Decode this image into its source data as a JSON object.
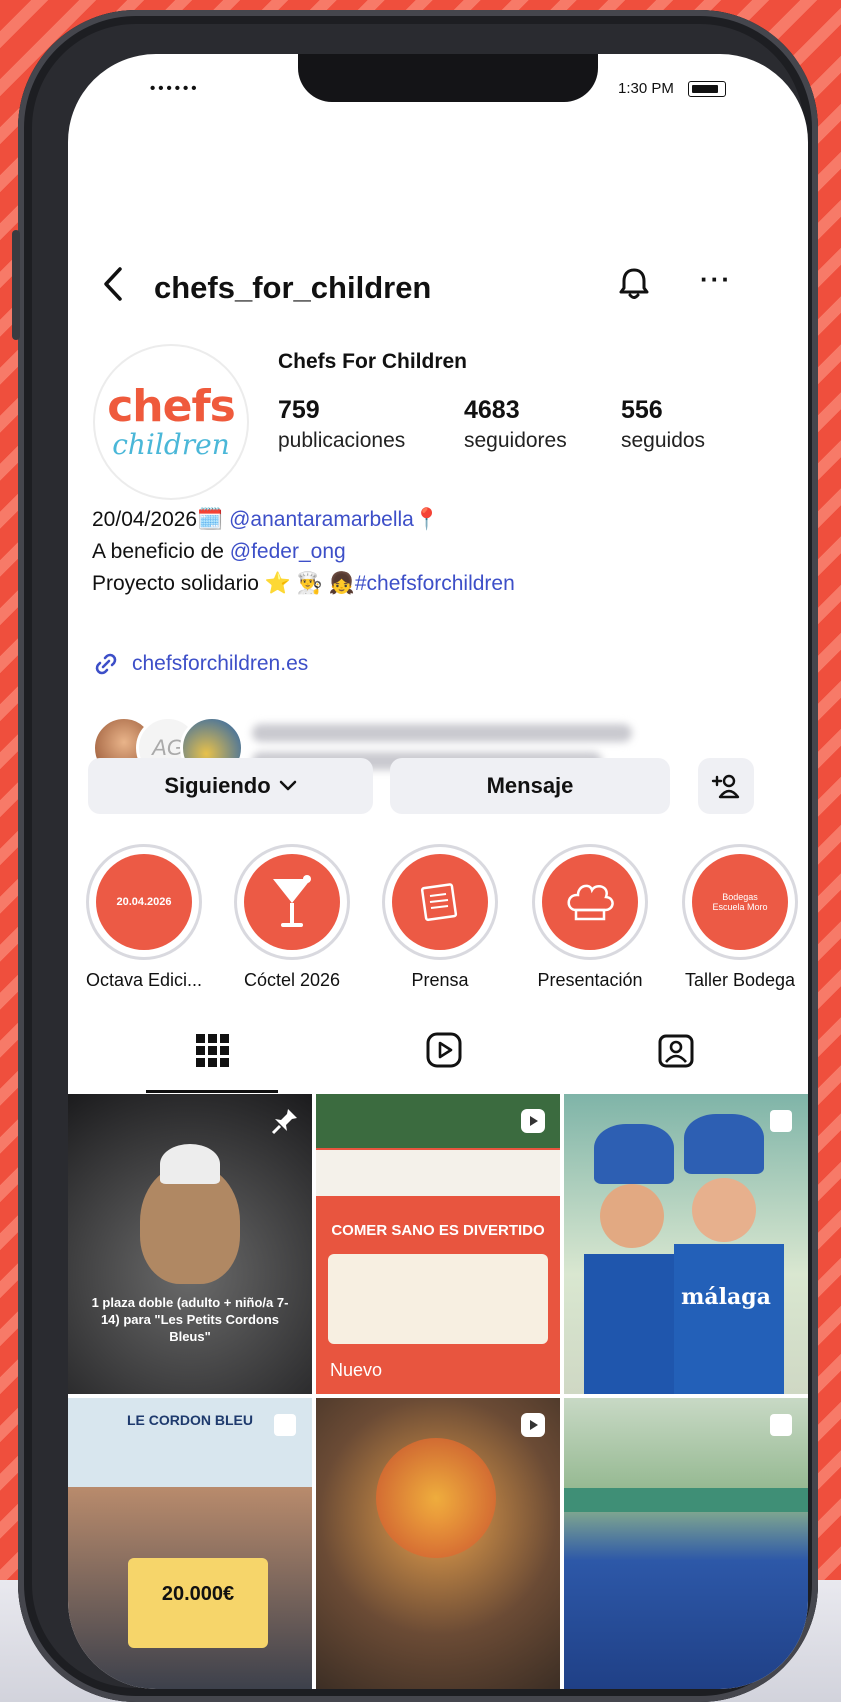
{
  "status_bar": {
    "carrier": "••••••",
    "time": "1:30 PM"
  },
  "header": {
    "username": "chefs_for_children"
  },
  "profile": {
    "logo_top": "chefs",
    "logo_bottom": "children",
    "display_name": "Chefs For Children",
    "stats": [
      {
        "value": "759",
        "label": "publicaciones"
      },
      {
        "value": "4683",
        "label": "seguidores"
      },
      {
        "value": "556",
        "label": "seguidos"
      }
    ],
    "bio": {
      "line1_text": "20/04/2026",
      "line1_emoji": "🗓️",
      "line1_mention": "@anantaramarbella",
      "line1_pin": "📍",
      "line2_text": "A beneficio de ",
      "line2_mention": "@feder_ong",
      "line3_text": "Proyecto solidario ⭐ 👨‍🍳 👧",
      "line3_hashtag": "#chefsforchildren",
      "url": "chefsforchildren.es"
    },
    "followers_preview": {
      "initials": "AG"
    }
  },
  "buttons": {
    "following": "Siguiendo",
    "message": "Mensaje"
  },
  "highlights": [
    {
      "label": "Octava Edici...",
      "inner_text": "20.04.2026"
    },
    {
      "label": "Cóctel 2026",
      "inner_text": ""
    },
    {
      "label": "Prensa",
      "inner_text": ""
    },
    {
      "label": "Presentación",
      "inner_text": ""
    },
    {
      "label": "Taller Bodega",
      "inner_text": "Bodegas Escuela Moro"
    }
  ],
  "posts": [
    {
      "caption": "1 plaza doble (adulto + niño/a 7-14) para \"Les Petits Cordons Bleus\"",
      "badge": "pin-icon"
    },
    {
      "caption": "COMER SANO ES DIVERTIDO",
      "tag": "Nuevo",
      "badge": "reel-icon"
    },
    {
      "caption": "málaga",
      "badge": "carousel-icon"
    },
    {
      "caption": "LE CORDON BLEU",
      "amount": "20.000€",
      "badge": "carousel-icon"
    },
    {
      "caption": "",
      "badge": "reel-icon"
    },
    {
      "caption": "",
      "badge": "carousel-icon"
    }
  ],
  "colors": {
    "accent": "#ec5a45",
    "link": "#3d4fc8",
    "background": "#ef4f3d"
  }
}
